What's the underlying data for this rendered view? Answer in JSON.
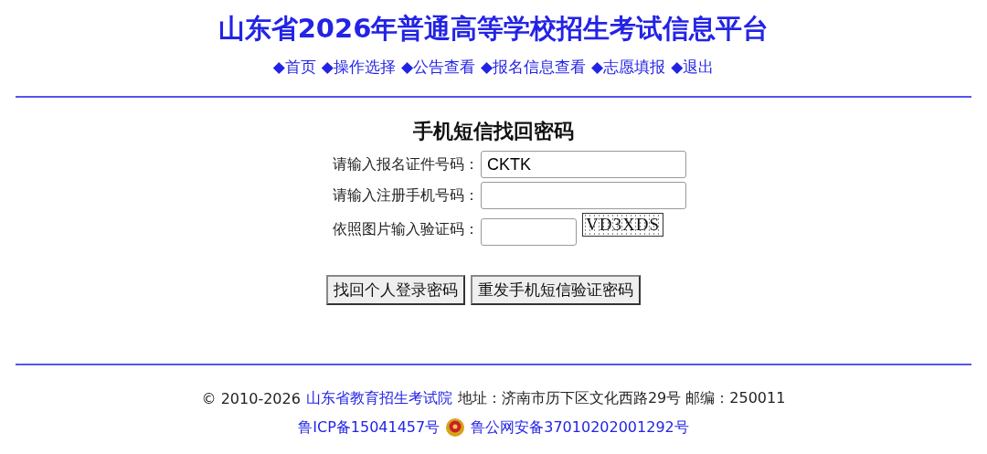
{
  "site_title": "山东省2026年普通高等学校招生考试信息平台",
  "nav": [
    "◆首页",
    "◆操作选择",
    "◆公告查看",
    "◆报名信息查看",
    "◆志愿填报",
    "◆退出"
  ],
  "form": {
    "title": "手机短信找回密码",
    "fields": [
      {
        "kind": "text",
        "label": "请输入报名证件号码：",
        "value": "CKTK"
      },
      {
        "kind": "text",
        "label": "请输入注册手机号码："
      },
      {
        "kind": "captcha",
        "label": "依照图片输入验证码：",
        "captcha": "VD3XDS"
      }
    ],
    "buttons": [
      "找回个人登录密码",
      "重发手机短信验证密码"
    ]
  },
  "footer": {
    "copyright": "© 2010-2026",
    "org_link": "山东省教育招生考试院",
    "address": "地址：济南市历下区文化西路29号 邮编：250011",
    "icp_link": "鲁ICP备15041457号",
    "police_link": "鲁公网安备37010202001292号"
  }
}
